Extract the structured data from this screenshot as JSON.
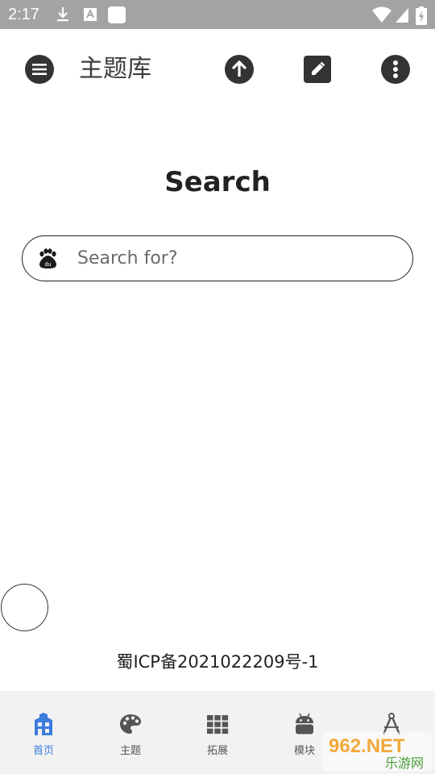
{
  "status_bar": {
    "time": "2:17",
    "icons": [
      "download-icon",
      "translate-icon",
      "app-square-icon",
      "wifi-icon",
      "signal-icon",
      "battery-charging-icon"
    ]
  },
  "app_bar": {
    "title": "主题库",
    "actions": [
      "menu-icon",
      "upload-icon",
      "edit-icon",
      "more-vertical-icon"
    ]
  },
  "search": {
    "heading": "Search",
    "placeholder": "Search for?",
    "engine_icon": "baidu-paw-icon"
  },
  "footer": {
    "icp": "蜀ICP备2021022209号-1"
  },
  "bottom_nav": {
    "items": [
      {
        "label": "首页",
        "icon": "building-icon",
        "active": true
      },
      {
        "label": "主题",
        "icon": "palette-icon",
        "active": false
      },
      {
        "label": "拓展",
        "icon": "grid-icon",
        "active": false
      },
      {
        "label": "模块",
        "icon": "android-icon",
        "active": false
      },
      {
        "label": "",
        "icon": "compass-tool-icon",
        "active": false
      }
    ]
  },
  "watermark": {
    "top_text": "962.NET",
    "bottom_text": "乐游网"
  },
  "colors": {
    "status_bar": "#a3a3a3",
    "accent": "#3b7ddd",
    "icon_dark": "#333333",
    "nav_background": "#f2f2f2"
  }
}
